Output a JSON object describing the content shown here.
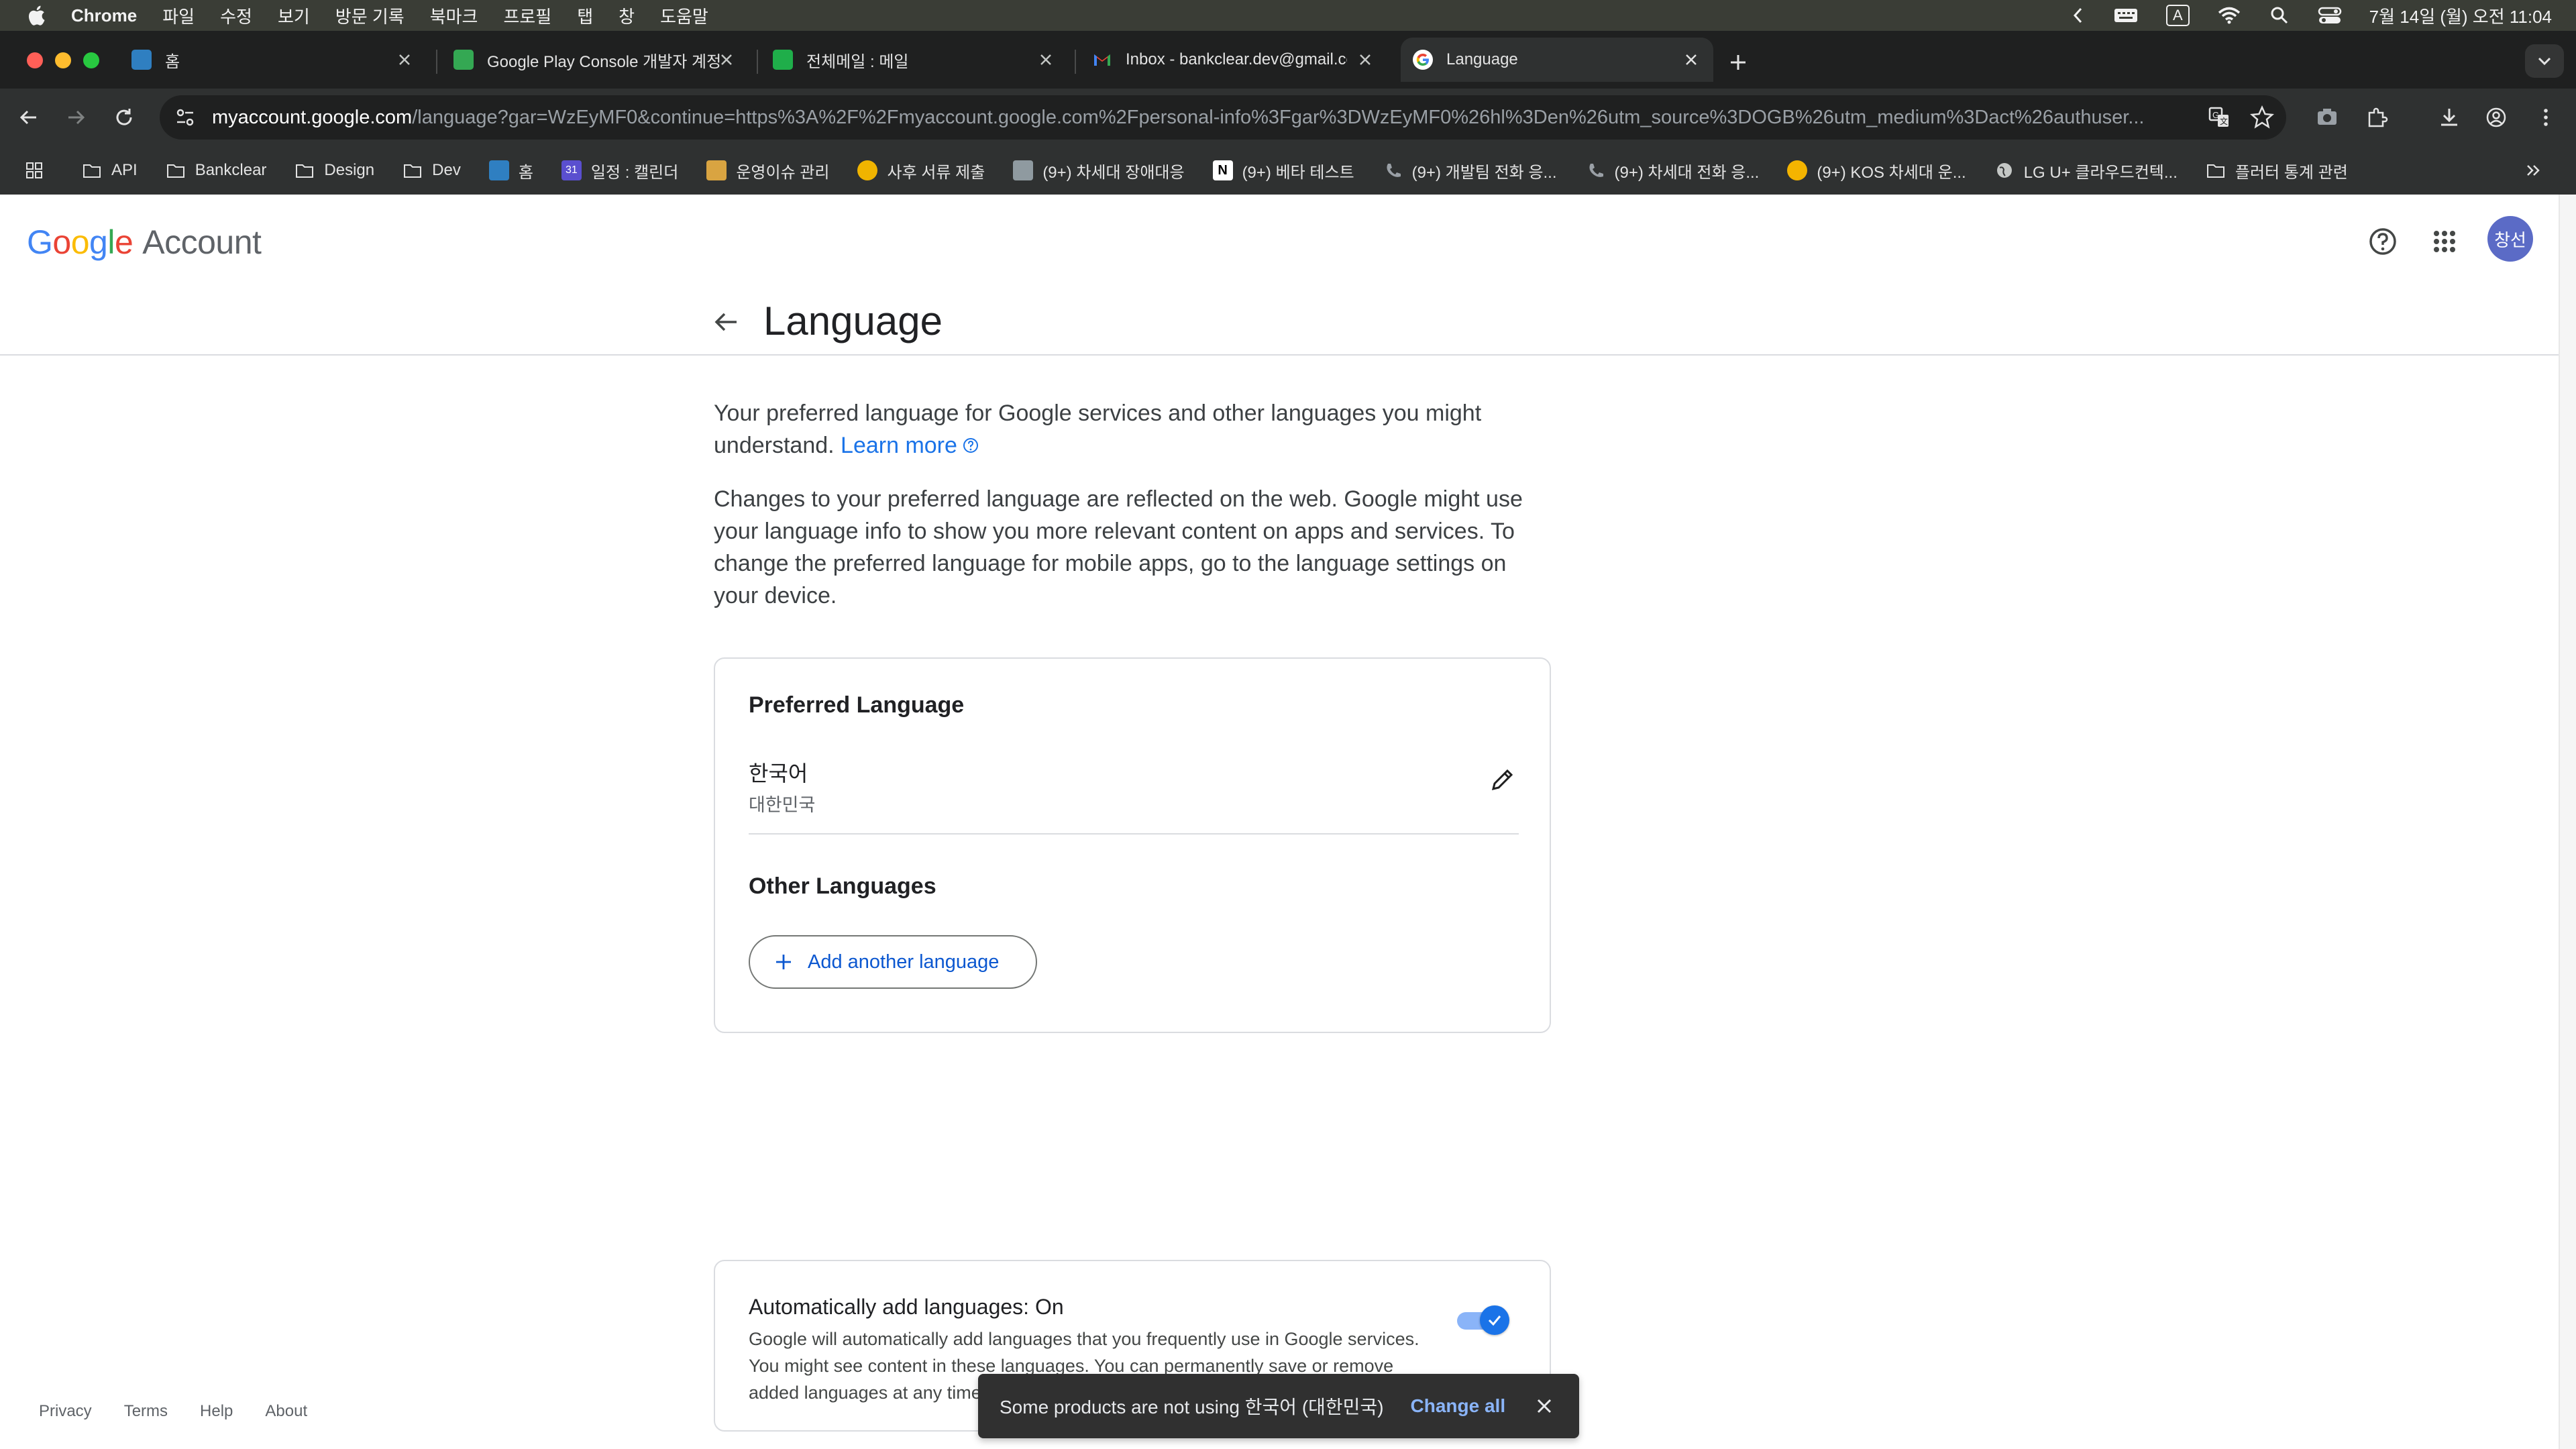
{
  "menubar": {
    "app_name": "Chrome",
    "items": [
      "파일",
      "수정",
      "보기",
      "방문 기록",
      "북마크",
      "프로필",
      "탭",
      "창",
      "도움말"
    ],
    "input_indicator": "A",
    "clock": "7월 14일 (월) 오전 11:04"
  },
  "tabs": [
    {
      "title": "홈",
      "favicon_color": "#2f7fc1"
    },
    {
      "title": "Google Play Console 개발자 계정",
      "favicon_color": "#34a853"
    },
    {
      "title": "전체메일 : 메일",
      "favicon_color": "#1fae4a"
    },
    {
      "title": "Inbox - bankclear.dev@gmail.com",
      "favicon_color": "#ea4335"
    },
    {
      "title": "Language",
      "favicon_color": "#4285f4"
    }
  ],
  "omnibox": {
    "host": "myaccount.google.com",
    "path": "/language?gar=WzEyMF0&continue=https%3A%2F%2Fmyaccount.google.com%2Fpersonal-info%3Fgar%3DWzEyMF0%26hl%3Den%26utm_source%3DOGB%26utm_medium%3Dact%26authuser..."
  },
  "bookmarks": [
    {
      "label": "",
      "icon": "apps-grid-icon"
    },
    {
      "label": "API",
      "icon": "folder-icon"
    },
    {
      "label": "Bankclear",
      "icon": "folder-icon"
    },
    {
      "label": "Design",
      "icon": "folder-icon"
    },
    {
      "label": "Dev",
      "icon": "folder-icon"
    },
    {
      "label": "홈",
      "icon": "site-icon"
    },
    {
      "label": "일정 : 캘린더",
      "icon": "calendar-icon"
    },
    {
      "label": "운영이슈 관리",
      "icon": "site-icon"
    },
    {
      "label": "사후 서류 제출",
      "icon": "site-icon"
    },
    {
      "label": "(9+) 차세대 장애대응",
      "icon": "site-icon"
    },
    {
      "label": "(9+) 베타 테스트",
      "icon": "notion-icon"
    },
    {
      "label": "(9+) 개발팀 전화 응...",
      "icon": "phone-icon"
    },
    {
      "label": "(9+) 차세대 전화 응...",
      "icon": "phone-icon"
    },
    {
      "label": "(9+) KOS 차세대 운...",
      "icon": "sun-icon"
    },
    {
      "label": "LG U+ 클라우드컨텍...",
      "icon": "globe-icon"
    },
    {
      "label": "플러터 통계 관련",
      "icon": "folder-icon"
    }
  ],
  "header": {
    "logo_google": "Google",
    "logo_account": "Account",
    "avatar_text": "창선"
  },
  "page": {
    "title": "Language",
    "intro_1": "Your preferred language for Google services and other languages you might understand.",
    "learn_more": "Learn more",
    "intro_2": "Changes to your preferred language are reflected on the web. Google might use your language info to show you more relevant content on apps and services. To change the preferred language for mobile apps, go to the language settings on your device."
  },
  "preferred": {
    "heading": "Preferred Language",
    "language": "한국어",
    "region": "대한민국"
  },
  "other": {
    "heading": "Other Languages",
    "add_button": "Add another language"
  },
  "auto_add": {
    "title": "Automatically add languages: On",
    "description": "Google will automatically add languages that you frequently use in Google services. You might see content in these languages. You can permanently save or remove added languages at any time.",
    "enabled": true
  },
  "footer": {
    "links": [
      "Privacy",
      "Terms",
      "Help",
      "About"
    ]
  },
  "snackbar": {
    "message": "Some products are not using 한국어 (대한민국)",
    "action": "Change all"
  },
  "colors": {
    "accent": "#1a73e8",
    "link": "#1a73e8",
    "avatar_bg": "#5b6bc6"
  }
}
